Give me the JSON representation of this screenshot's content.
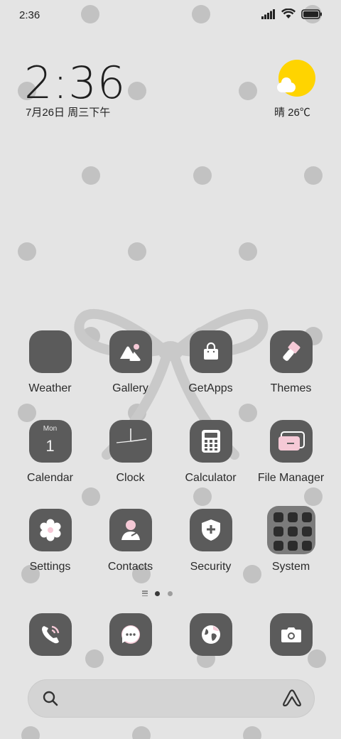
{
  "status_bar": {
    "time": "2:36",
    "icons": [
      "signal-icon",
      "wifi-icon",
      "battery-icon"
    ]
  },
  "clock_widget": {
    "time": "2:36",
    "date": "7月26日 周三下午"
  },
  "weather_widget": {
    "condition_icon": "sun-cloud-icon",
    "text": "晴 26℃"
  },
  "apps": [
    {
      "label": "Weather",
      "icon": "weather-icon"
    },
    {
      "label": "Gallery",
      "icon": "gallery-icon"
    },
    {
      "label": "GetApps",
      "icon": "shopping-bag-icon"
    },
    {
      "label": "Themes",
      "icon": "paintbrush-icon"
    },
    {
      "label": "Calendar",
      "icon": "calendar-icon",
      "day": "Mon",
      "date": "1"
    },
    {
      "label": "Clock",
      "icon": "clock-icon"
    },
    {
      "label": "Calculator",
      "icon": "calculator-icon"
    },
    {
      "label": "File Manager",
      "icon": "folder-icon"
    },
    {
      "label": "Settings",
      "icon": "gear-icon"
    },
    {
      "label": "Contacts",
      "icon": "person-icon"
    },
    {
      "label": "Security",
      "icon": "shield-plus-icon"
    },
    {
      "label": "System",
      "icon": "system-folder-icon"
    }
  ],
  "page_indicator": {
    "pages": 2,
    "current": 1
  },
  "dock": [
    {
      "name": "phone",
      "icon": "phone-icon"
    },
    {
      "name": "messages",
      "icon": "chat-bubble-icon"
    },
    {
      "name": "browser",
      "icon": "globe-icon"
    },
    {
      "name": "camera",
      "icon": "camera-icon"
    }
  ],
  "search_bar": {
    "left_icon": "search-icon",
    "right_icon": "assistant-icon"
  },
  "colors": {
    "background": "#e4e4e4",
    "icon_tile": "#5b5b5b",
    "accent_pink": "#f5c9d6",
    "sun": "#ffd400"
  }
}
